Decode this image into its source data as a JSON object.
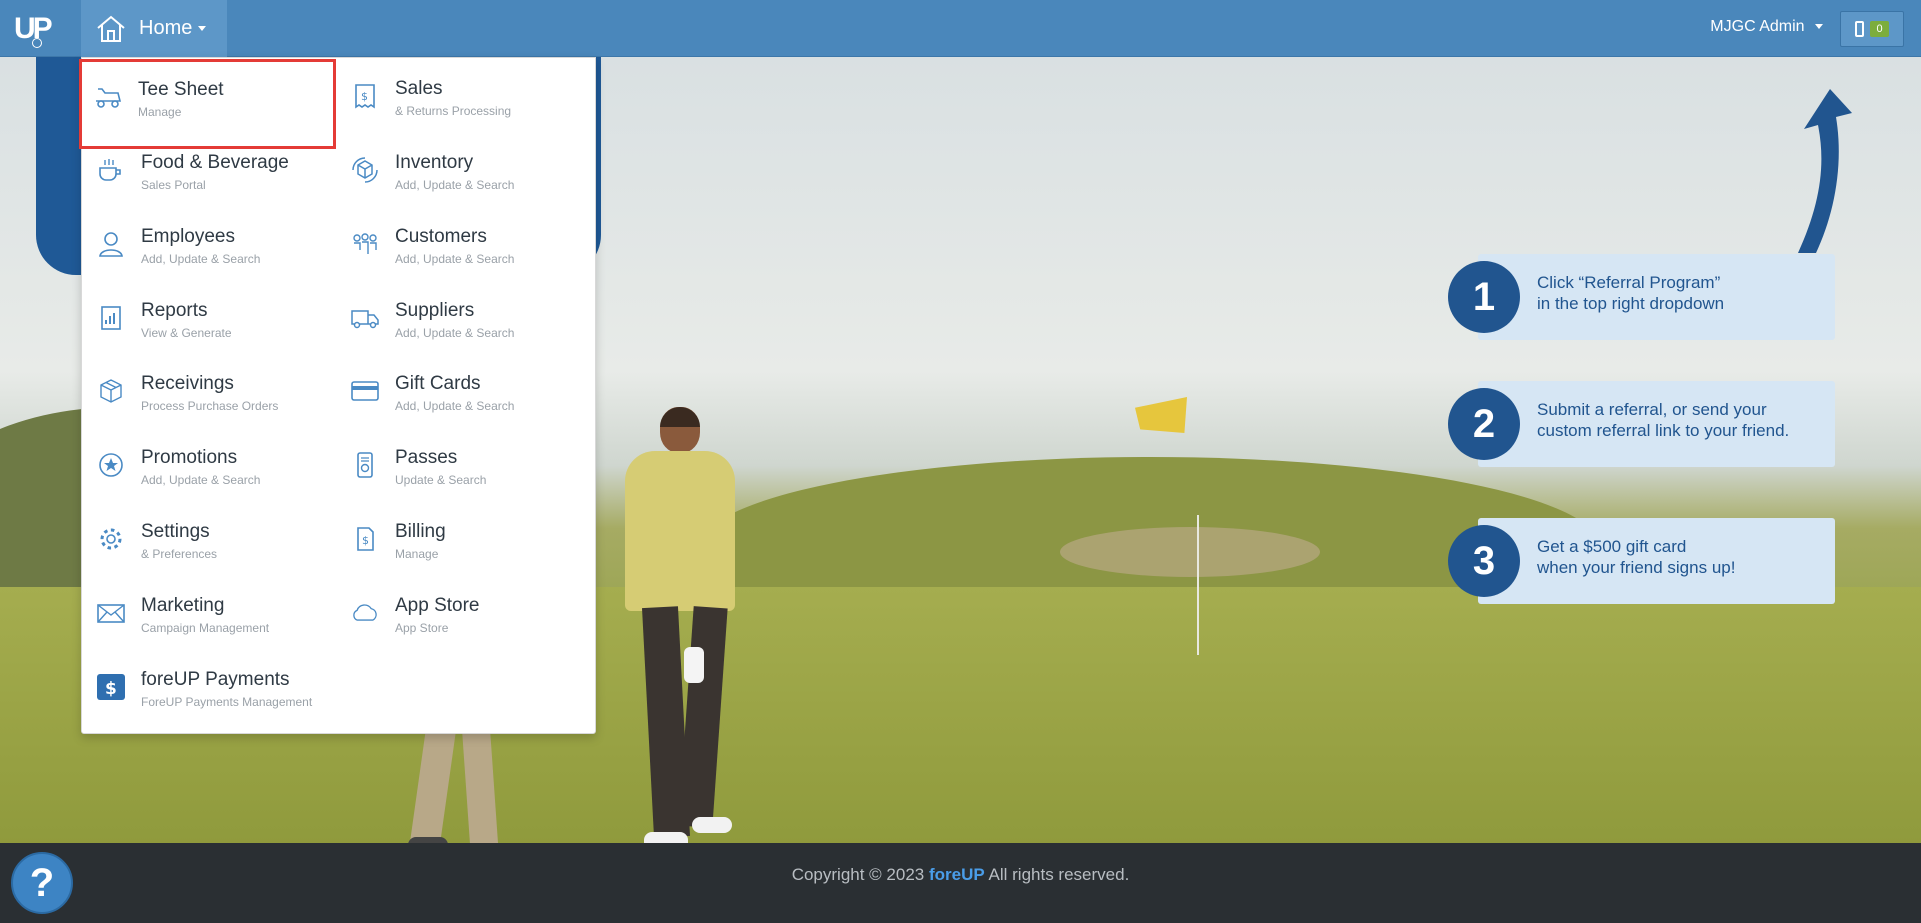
{
  "navbar": {
    "logo_text": "UP",
    "home_label": "Home",
    "user_label": "MJGC Admin",
    "device_count": "0"
  },
  "menu": {
    "items": [
      {
        "title": "Tee Sheet",
        "sub": "Manage",
        "icon": "golf-cart-icon"
      },
      {
        "title": "Sales",
        "sub": "& Returns Processing",
        "icon": "receipt-icon"
      },
      {
        "title": "Food & Beverage",
        "sub": "Sales Portal",
        "icon": "coffee-cup-icon"
      },
      {
        "title": "Inventory",
        "sub": "Add, Update & Search",
        "icon": "inventory-box-icon"
      },
      {
        "title": "Employees",
        "sub": "Add, Update & Search",
        "icon": "employee-icon"
      },
      {
        "title": "Customers",
        "sub": "Add, Update & Search",
        "icon": "customers-icon"
      },
      {
        "title": "Reports",
        "sub": "View & Generate",
        "icon": "report-icon"
      },
      {
        "title": "Suppliers",
        "sub": "Add, Update & Search",
        "icon": "truck-icon"
      },
      {
        "title": "Receivings",
        "sub": "Process Purchase Orders",
        "icon": "package-icon"
      },
      {
        "title": "Gift Cards",
        "sub": "Add, Update & Search",
        "icon": "credit-card-icon"
      },
      {
        "title": "Promotions",
        "sub": "Add, Update & Search",
        "icon": "star-badge-icon"
      },
      {
        "title": "Passes",
        "sub": "Update & Search",
        "icon": "pass-icon"
      },
      {
        "title": "Settings",
        "sub": "& Preferences",
        "icon": "gear-icon"
      },
      {
        "title": "Billing",
        "sub": "Manage",
        "icon": "billing-icon"
      },
      {
        "title": "Marketing",
        "sub": "Campaign Management",
        "icon": "envelope-icon"
      },
      {
        "title": "App Store",
        "sub": "App Store",
        "icon": "cloud-icon"
      },
      {
        "title": "foreUP Payments",
        "sub": "ForeUP Payments Management",
        "icon": "dollar-square-icon"
      }
    ]
  },
  "referral": {
    "steps": [
      {
        "num": "1",
        "line1": "Click “Referral Program”",
        "line2": "in the top right dropdown"
      },
      {
        "num": "2",
        "line1": "Submit a referral, or send your",
        "line2": "custom referral link to your friend."
      },
      {
        "num": "3",
        "line1": "Get a $500 gift card",
        "line2": "when your friend signs up!"
      }
    ]
  },
  "footer": {
    "copyright_prefix": "Copyright © 2023",
    "brand": "foreUP",
    "copyright_suffix": "All rights reserved.",
    "help_label": "?"
  },
  "colors": {
    "navbar": "#4a87bb",
    "accent": "#4a8ac4",
    "highlight_border": "#e43b36",
    "referral_blue": "#21558f"
  }
}
